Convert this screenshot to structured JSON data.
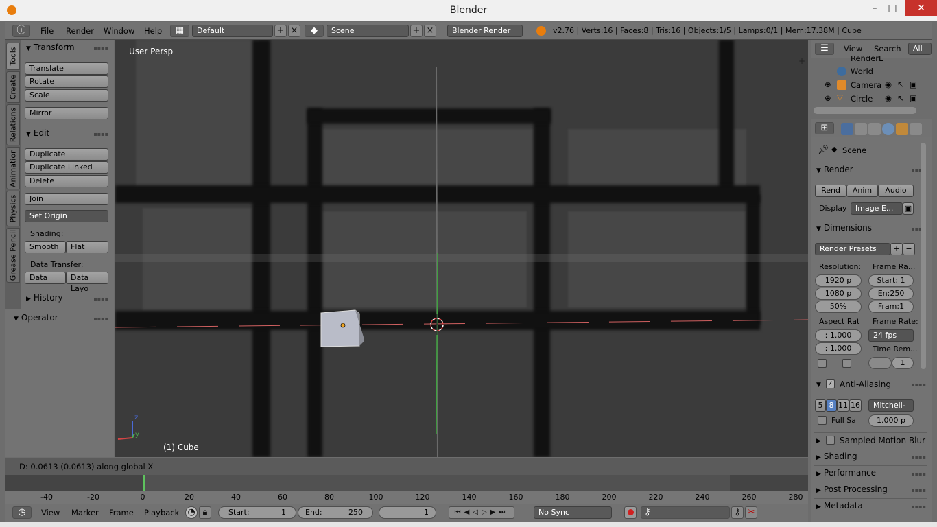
{
  "window": {
    "title": "Blender",
    "minimize": "–",
    "maximize": "□",
    "close": "✕"
  },
  "infobar": {
    "menus": [
      "File",
      "Render",
      "Window",
      "Help"
    ],
    "layout": "Default",
    "scene": "Scene",
    "engine": "Blender Render",
    "stats": "v2.76 | Verts:16 | Faces:8 | Tris:16 | Objects:1/5 | Lamps:0/1 | Mem:17.38M | Cube"
  },
  "toolshelf": {
    "tabs": [
      "Tools",
      "Create",
      "Relations",
      "Animation",
      "Physics",
      "Grease Pencil"
    ],
    "transform": {
      "title": "Transform",
      "buttons": [
        "Translate",
        "Rotate",
        "Scale",
        "Mirror"
      ]
    },
    "edit": {
      "title": "Edit",
      "buttons": [
        "Duplicate",
        "Duplicate Linked",
        "Delete",
        "Join"
      ],
      "set_origin": "Set Origin"
    },
    "shading": {
      "label": "Shading:",
      "smooth": "Smooth",
      "flat": "Flat"
    },
    "data_transfer": {
      "label": "Data Transfer:",
      "data": "Data",
      "data_layout": "Data Layo"
    },
    "history": "History",
    "operator": "Operator"
  },
  "viewport": {
    "view_label": "User Persp",
    "object_label": "(1) Cube",
    "axis_z": "z",
    "axis_y": "y"
  },
  "status": {
    "text": "D: 0.0613 (0.0613) along global X"
  },
  "timeline": {
    "ticks": [
      "-40",
      "-20",
      "0",
      "20",
      "40",
      "60",
      "80",
      "100",
      "120",
      "140",
      "160",
      "180",
      "200",
      "220",
      "240",
      "260",
      "280"
    ],
    "menus": [
      "View",
      "Marker",
      "Frame",
      "Playback"
    ],
    "start_label": "Start:",
    "start": "1",
    "end_label": "End:",
    "end": "250",
    "current": "1",
    "sync": "No Sync"
  },
  "outliner": {
    "menus": [
      "View",
      "Search"
    ],
    "filter": "All Sc",
    "rows": [
      "RenderL",
      "World",
      "Camera",
      "Circle"
    ]
  },
  "properties": {
    "scene": "Scene",
    "render": {
      "title": "Render",
      "render_btn": "Rend",
      "anim_btn": "Anim",
      "audio_btn": "Audio",
      "display_label": "Display",
      "display_value": "Image E..."
    },
    "dimensions": {
      "title": "Dimensions",
      "presets": "Render Presets",
      "resolution_label": "Resolution:",
      "res_x": "1920 p",
      "res_y": "1080 p",
      "res_pct": "50%",
      "frame_range_label": "Frame Ra...",
      "frame_start": "Start: 1",
      "frame_end": "En:250",
      "frame_step": "Fram:1",
      "aspect_label": "Aspect Rat",
      "aspect_x": ": 1.000",
      "aspect_y": ": 1.000",
      "frame_rate_label": "Frame Rate:",
      "fps": "24 fps",
      "time_remap_label": "Time Rem...",
      "time_remap_value": "1"
    },
    "antialiasing": {
      "title": "Anti-Aliasing",
      "samples": [
        "5",
        "8",
        "11",
        "16"
      ],
      "filter": "Mitchell-",
      "full_sample": "Full Sa",
      "size": "1.000 p"
    },
    "sections": [
      "Sampled Motion Blur",
      "Shading",
      "Performance",
      "Post Processing",
      "Metadata"
    ]
  }
}
